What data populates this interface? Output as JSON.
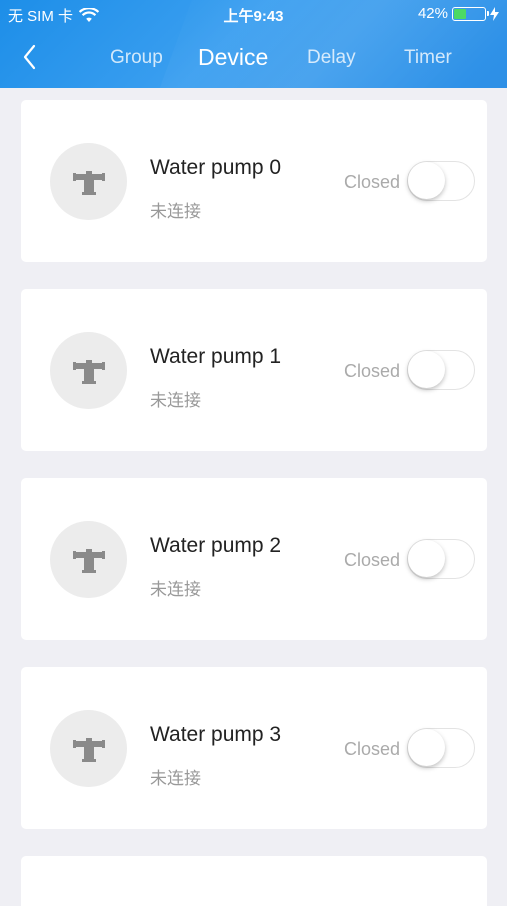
{
  "status_bar": {
    "carrier": "无 SIM 卡",
    "time": "上午9:43",
    "battery": "42%",
    "battery_level": 0.42
  },
  "nav": {
    "tabs": [
      {
        "label": "Group",
        "active": false
      },
      {
        "label": "Device",
        "active": true
      },
      {
        "label": "Delay",
        "active": false
      },
      {
        "label": "Timer",
        "active": false
      }
    ]
  },
  "devices": [
    {
      "name": "Water pump 0",
      "status": "未连接",
      "state": "Closed",
      "on": false,
      "icon": "water-pump-icon"
    },
    {
      "name": "Water pump 1",
      "status": "未连接",
      "state": "Closed",
      "on": false,
      "icon": "water-pump-icon"
    },
    {
      "name": "Water pump 2",
      "status": "未连接",
      "state": "Closed",
      "on": false,
      "icon": "water-pump-icon"
    },
    {
      "name": "Water pump 3",
      "status": "未连接",
      "state": "Closed",
      "on": false,
      "icon": "water-pump-icon"
    }
  ],
  "colors": {
    "header": "#2a93ea",
    "background": "#efeff4",
    "battery_fill": "#4cd964"
  }
}
